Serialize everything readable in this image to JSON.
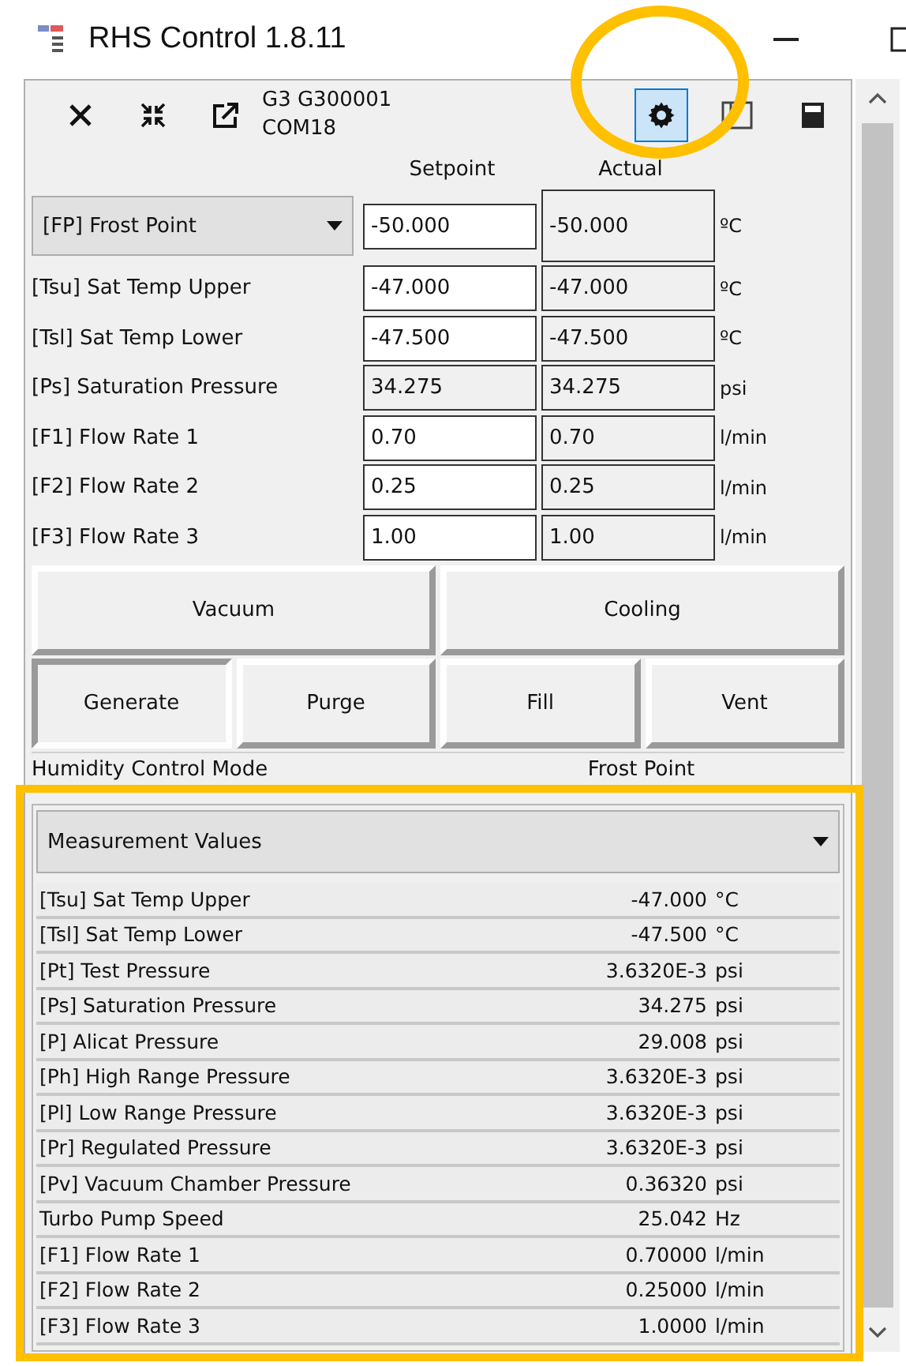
{
  "window": {
    "title": "RHS Control 1.8.11"
  },
  "toolbar": {
    "device": "G3 G300001",
    "port": "COM18",
    "buttons": [
      {
        "kind": "close",
        "selected": false
      },
      {
        "kind": "collapse",
        "selected": false
      },
      {
        "kind": "popout",
        "selected": false
      },
      {
        "kind": "settings",
        "selected": true
      },
      {
        "kind": "panel",
        "selected": false
      },
      {
        "kind": "calculator",
        "selected": false
      }
    ]
  },
  "setpoints": {
    "columns": [
      "Setpoint",
      "Actual"
    ],
    "rows": [
      {
        "kind": "select",
        "label": "[FP] Frost Point",
        "setpoint": "-50.000",
        "actual": "-50.000",
        "unit": "ºC",
        "editable": true
      },
      {
        "kind": "plain",
        "label": "[Tsu] Sat Temp Upper",
        "setpoint": "-47.000",
        "actual": "-47.000",
        "unit": "ºC",
        "editable": true
      },
      {
        "kind": "plain",
        "label": "[Tsl] Sat Temp Lower",
        "setpoint": "-47.500",
        "actual": "-47.500",
        "unit": "ºC",
        "editable": true
      },
      {
        "kind": "plain",
        "label": "[Ps] Saturation Pressure",
        "setpoint": "34.275",
        "actual": "34.275",
        "unit": "psi",
        "editable": false
      },
      {
        "kind": "plain",
        "label": "[F1] Flow Rate 1",
        "setpoint": "0.70",
        "actual": "0.70",
        "unit": "l/min",
        "editable": true
      },
      {
        "kind": "plain",
        "label": "[F2] Flow Rate 2",
        "setpoint": "0.25",
        "actual": "0.25",
        "unit": "l/min",
        "editable": true
      },
      {
        "kind": "plain",
        "label": "[F3] Flow Rate 3",
        "setpoint": "1.00",
        "actual": "1.00",
        "unit": "l/min",
        "editable": true
      }
    ]
  },
  "action_rows": [
    {
      "buttons": [
        {
          "label": "Vacuum",
          "pressed": false
        },
        {
          "label": "Cooling",
          "pressed": false
        }
      ]
    },
    {
      "buttons": [
        {
          "label": "Generate",
          "pressed": true
        },
        {
          "label": "Purge",
          "pressed": false
        },
        {
          "label": "Fill",
          "pressed": false
        },
        {
          "label": "Vent",
          "pressed": false
        }
      ]
    }
  ],
  "status": {
    "label": "Humidity Control Mode",
    "value": "Frost Point"
  },
  "measurements": {
    "view": "Measurement Values",
    "rows": [
      {
        "label": "[Tsu] Sat Temp Upper",
        "value": "-47.000",
        "unit": "°C"
      },
      {
        "label": "[Tsl] Sat Temp Lower",
        "value": "-47.500",
        "unit": "°C"
      },
      {
        "label": "[Pt] Test Pressure",
        "value": "3.6320E-3",
        "unit": "psi"
      },
      {
        "label": "[Ps] Saturation Pressure",
        "value": "34.275",
        "unit": "psi"
      },
      {
        "label": "[P] Alicat Pressure",
        "value": "29.008",
        "unit": "psi"
      },
      {
        "label": "[Ph] High Range Pressure",
        "value": "3.6320E-3",
        "unit": "psi"
      },
      {
        "label": "[Pl] Low Range Pressure",
        "value": "3.6320E-3",
        "unit": "psi"
      },
      {
        "label": "[Pr] Regulated Pressure",
        "value": "3.6320E-3",
        "unit": "psi"
      },
      {
        "label": "[Pv] Vacuum Chamber Pressure",
        "value": "0.36320",
        "unit": "psi"
      },
      {
        "label": "Turbo Pump Speed",
        "value": "25.042",
        "unit": "Hz"
      },
      {
        "label": "[F1] Flow Rate 1",
        "value": "0.70000",
        "unit": "l/min"
      },
      {
        "label": "[F2] Flow Rate 2",
        "value": "0.25000",
        "unit": "l/min"
      },
      {
        "label": "[F3] Flow Rate 3",
        "value": "1.0000",
        "unit": "l/min"
      }
    ]
  }
}
